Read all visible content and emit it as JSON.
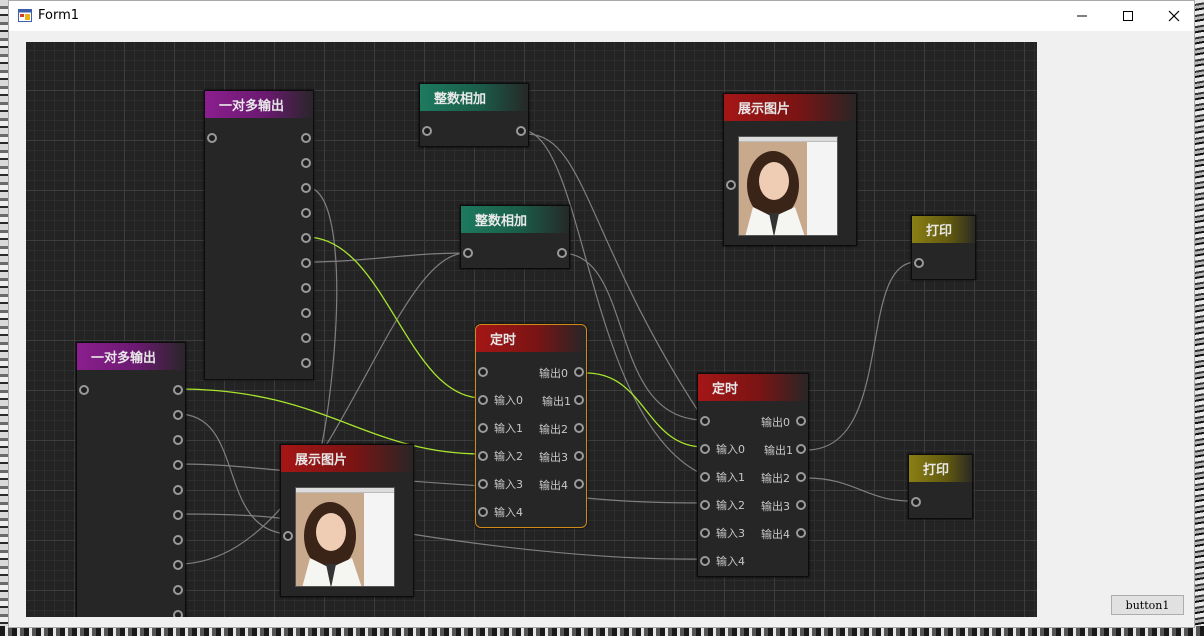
{
  "window": {
    "title": "Form1"
  },
  "button1_label": "button1",
  "colors": {
    "wire": "#8f8f8f",
    "wire_active": "#a8e62e",
    "header_purple": "#8b1e8e",
    "header_green": "#1d7a5e",
    "header_red": "#a51616",
    "header_yellow": "#8a7f14",
    "selection": "#d08a17"
  },
  "icons": [
    "form-app-icon",
    "minimize-icon",
    "maximize-icon",
    "close-icon"
  ],
  "nodes": {
    "one_to_many_a": {
      "title": "一对多输出"
    },
    "one_to_many_b": {
      "title": "一对多输出"
    },
    "int_add_a": {
      "title": "整数相加"
    },
    "int_add_b": {
      "title": "整数相加"
    },
    "show_image_a": {
      "title": "展示图片"
    },
    "show_image_b": {
      "title": "展示图片"
    },
    "timer_a": {
      "title": "定时",
      "inputs": [
        "输入0",
        "输入1",
        "输入2",
        "输入3",
        "输入4"
      ],
      "outputs": [
        "输出0",
        "输出1",
        "输出2",
        "输出3",
        "输出4"
      ]
    },
    "timer_b": {
      "title": "定时",
      "inputs": [
        "输入0",
        "输入1",
        "输入2",
        "输入3",
        "输入4"
      ],
      "outputs": [
        "输出0",
        "输出1",
        "输出2",
        "输出3",
        "输出4"
      ]
    },
    "print_a": {
      "title": "打印"
    },
    "print_b": {
      "title": "打印"
    }
  }
}
